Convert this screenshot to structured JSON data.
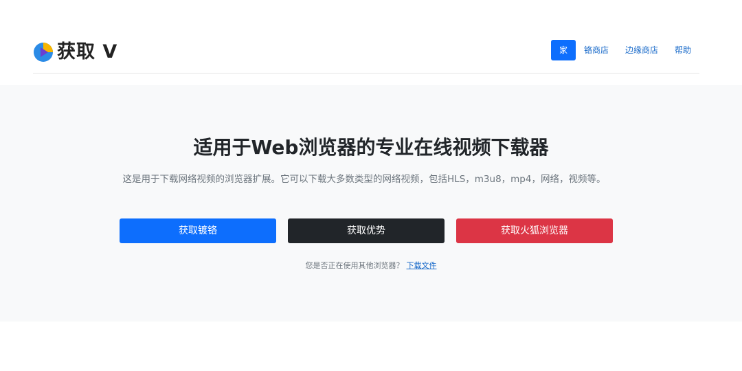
{
  "header": {
    "brand": "获取 V",
    "colors": {
      "logo_blue": "#2b8be6",
      "logo_yellow": "#f7b500",
      "logo_purple": "#6a3fd0"
    },
    "nav": [
      {
        "label": "家",
        "active": true
      },
      {
        "label": "铬商店",
        "active": false
      },
      {
        "label": "边缘商店",
        "active": false
      },
      {
        "label": "帮助",
        "active": false
      }
    ]
  },
  "hero": {
    "title": "适用于Web浏览器的专业在线视频下载器",
    "description": "这是用于下载网络视频的浏览器扩展。它可以下载大多数类型的网络视频，包括HLS，m3u8，mp4，网络，视频等。",
    "buttons": [
      {
        "label": "获取镀铬",
        "color": "#0d6efd"
      },
      {
        "label": "获取优势",
        "color": "#212529"
      },
      {
        "label": "获取火狐浏览器",
        "color": "#dc3545"
      }
    ],
    "other_prompt": "您是否正在使用其他浏览器？",
    "other_link": "下载文件"
  }
}
